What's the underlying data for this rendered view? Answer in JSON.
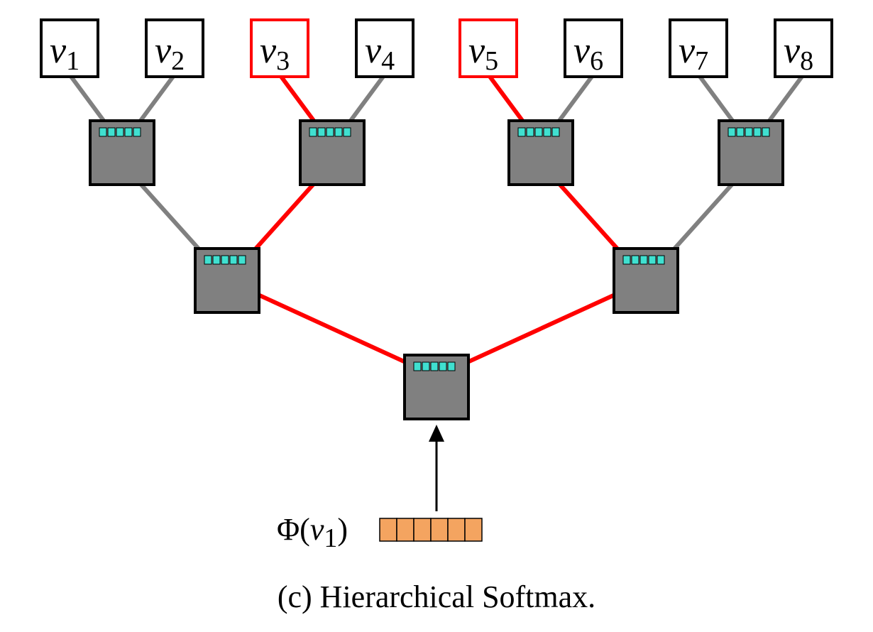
{
  "caption": "(c) Hierarchical Softmax.",
  "input_label_prefix": "Φ(",
  "input_label_var": "v",
  "input_label_sub": "1",
  "input_label_suffix": ")",
  "leaves": [
    {
      "var": "v",
      "sub": "1",
      "highlight": false
    },
    {
      "var": "v",
      "sub": "2",
      "highlight": false
    },
    {
      "var": "v",
      "sub": "3",
      "highlight": true
    },
    {
      "var": "v",
      "sub": "4",
      "highlight": false
    },
    {
      "var": "v",
      "sub": "5",
      "highlight": true
    },
    {
      "var": "v",
      "sub": "6",
      "highlight": false
    },
    {
      "var": "v",
      "sub": "7",
      "highlight": false
    },
    {
      "var": "v",
      "sub": "8",
      "highlight": false
    }
  ],
  "colors": {
    "highlight": "#ff0000",
    "edge": "#808080",
    "node_fill": "#808080",
    "chip": "#40e0d0",
    "input_vector": "#f4a460"
  }
}
